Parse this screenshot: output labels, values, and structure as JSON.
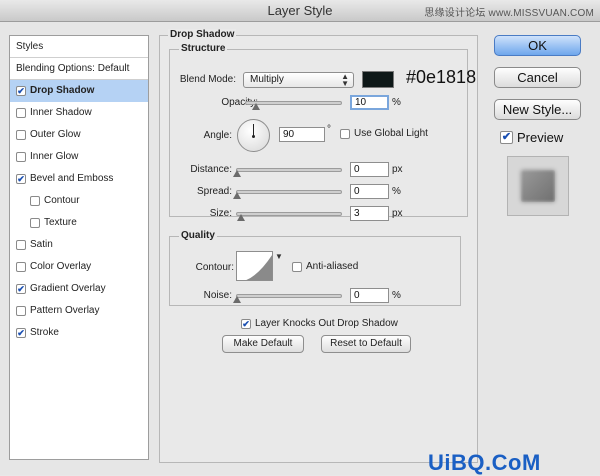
{
  "window": {
    "title": "Layer Style"
  },
  "watermark_top": "思缘设计论坛 www.MISSVUAN.COM",
  "watermark_bottom": "UiBQ.CoM",
  "styles_panel": {
    "header": "Styles",
    "blending_options": "Blending Options: Default",
    "items": [
      {
        "label": "Drop Shadow",
        "checked": true,
        "selected": true,
        "indent": false
      },
      {
        "label": "Inner Shadow",
        "checked": false,
        "selected": false,
        "indent": false
      },
      {
        "label": "Outer Glow",
        "checked": false,
        "selected": false,
        "indent": false
      },
      {
        "label": "Inner Glow",
        "checked": false,
        "selected": false,
        "indent": false
      },
      {
        "label": "Bevel and Emboss",
        "checked": true,
        "selected": false,
        "indent": false
      },
      {
        "label": "Contour",
        "checked": false,
        "selected": false,
        "indent": true
      },
      {
        "label": "Texture",
        "checked": false,
        "selected": false,
        "indent": true
      },
      {
        "label": "Satin",
        "checked": false,
        "selected": false,
        "indent": false
      },
      {
        "label": "Color Overlay",
        "checked": false,
        "selected": false,
        "indent": false
      },
      {
        "label": "Gradient Overlay",
        "checked": true,
        "selected": false,
        "indent": false
      },
      {
        "label": "Pattern Overlay",
        "checked": false,
        "selected": false,
        "indent": false
      },
      {
        "label": "Stroke",
        "checked": true,
        "selected": false,
        "indent": false
      }
    ]
  },
  "drop_shadow": {
    "title": "Drop Shadow",
    "structure": {
      "title": "Structure",
      "blend_mode_label": "Blend Mode:",
      "blend_mode_value": "Multiply",
      "color": "#0e1818",
      "color_annotation": "#0e1818",
      "opacity_label": "Opacity:",
      "opacity_value": "10",
      "opacity_unit": "%",
      "opacity_percent": 10,
      "angle_label": "Angle:",
      "angle_value": "90",
      "angle_unit": "°",
      "use_global_light_label": "Use Global Light",
      "use_global_light": false,
      "distance_label": "Distance:",
      "distance_value": "0",
      "distance_unit": "px",
      "spread_label": "Spread:",
      "spread_value": "0",
      "spread_unit": "%",
      "size_label": "Size:",
      "size_value": "3",
      "size_unit": "px"
    },
    "quality": {
      "title": "Quality",
      "contour_label": "Contour:",
      "anti_aliased_label": "Anti-aliased",
      "anti_aliased": false,
      "noise_label": "Noise:",
      "noise_value": "0",
      "noise_unit": "%"
    },
    "knocks_out_label": "Layer Knocks Out Drop Shadow",
    "knocks_out": true,
    "make_default_label": "Make Default",
    "reset_default_label": "Reset to Default"
  },
  "buttons": {
    "ok": "OK",
    "cancel": "Cancel",
    "new_style": "New Style..."
  },
  "preview": {
    "label": "Preview",
    "checked": true
  }
}
